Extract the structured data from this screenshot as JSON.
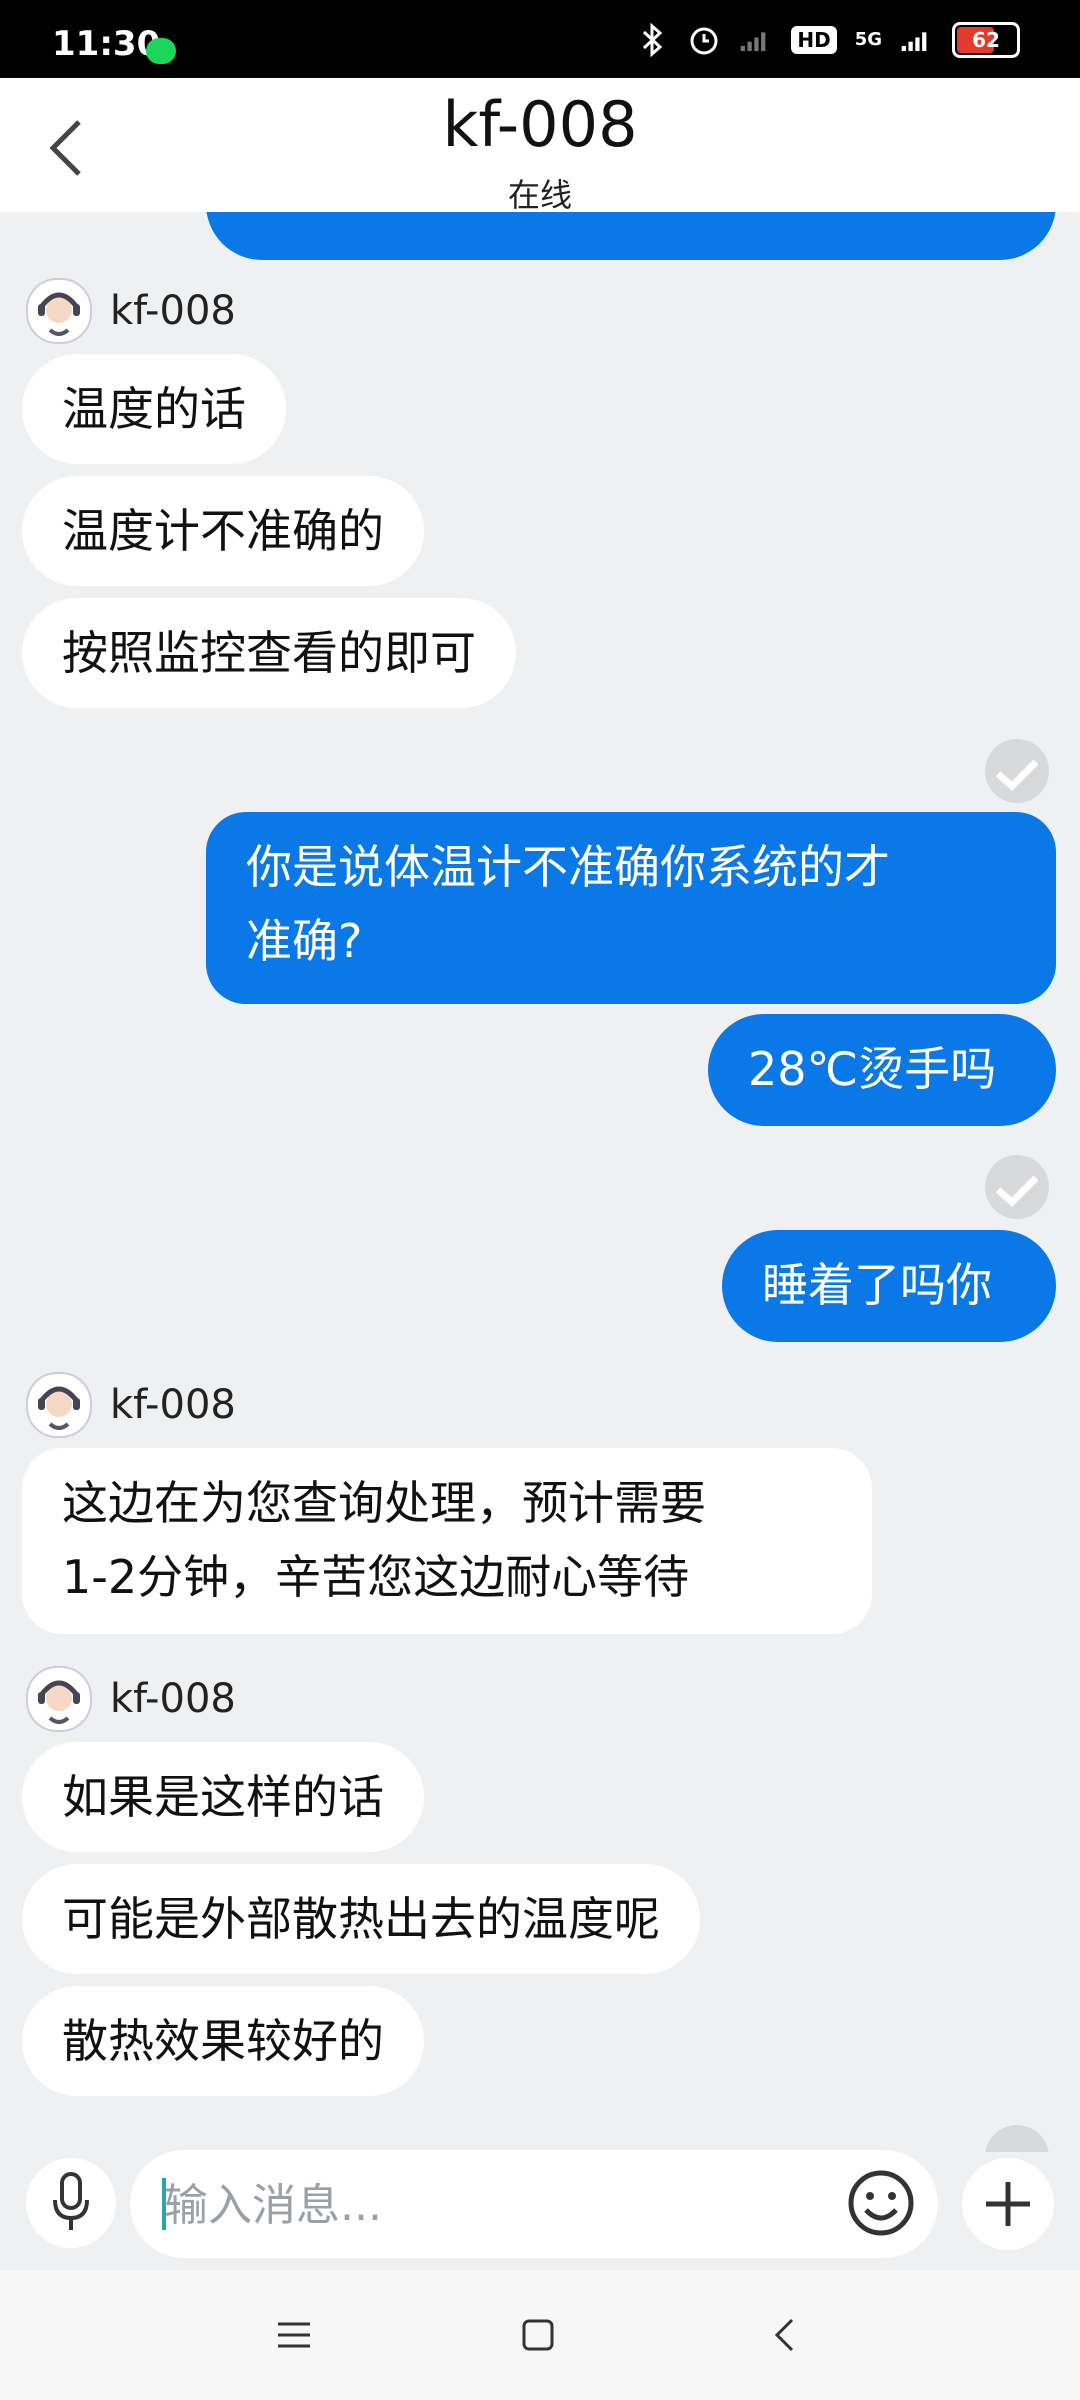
{
  "status_bar": {
    "time": "11:30",
    "network": "5G",
    "hd": "HD",
    "battery_level": "62"
  },
  "header": {
    "title": "kf-008",
    "subtitle": "在线"
  },
  "messages": [
    {
      "sender": "kf-008"
    },
    {
      "text": "温度的话"
    },
    {
      "text": "温度计不准确的"
    },
    {
      "text": "按照监控查看的即可"
    },
    {
      "text_line1": "你是说体温计不准确你系统的才",
      "text_line2": "准确?"
    },
    {
      "text": "28℃烫手吗"
    },
    {
      "text": "睡着了吗你"
    },
    {
      "sender": "kf-008"
    },
    {
      "text_line1": "这边在为您查询处理，预计需要",
      "text_line2": "1-2分钟，辛苦您这边耐心等待"
    },
    {
      "sender": "kf-008"
    },
    {
      "text": "如果是这样的话"
    },
    {
      "text": "可能是外部散热出去的温度呢"
    },
    {
      "text": "散热效果较好的"
    }
  ],
  "composer": {
    "placeholder": "输入消息..."
  },
  "colors": {
    "accent": "#0a78e6",
    "incoming_bubble": "#ffffff",
    "background": "#eef0f1"
  }
}
